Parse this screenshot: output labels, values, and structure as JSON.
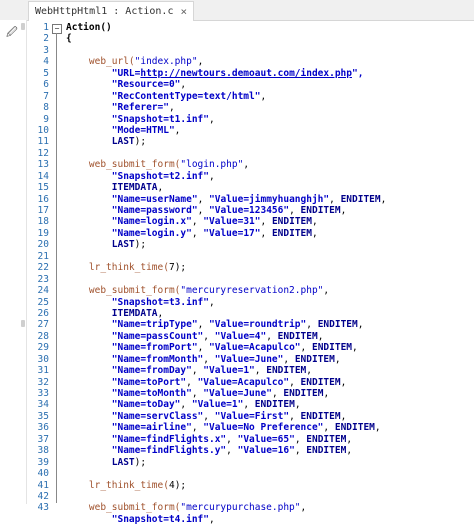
{
  "tab": {
    "title": "WebHttpHtml1 : Action.c",
    "close": "×"
  },
  "line_numbers": [
    "1",
    "2",
    "3",
    "4",
    "5",
    "6",
    "7",
    "8",
    "9",
    "10",
    "11",
    "12",
    "13",
    "14",
    "15",
    "16",
    "17",
    "18",
    "19",
    "20",
    "21",
    "22",
    "23",
    "24",
    "25",
    "26",
    "27",
    "28",
    "29",
    "30",
    "31",
    "32",
    "33",
    "34",
    "35",
    "36",
    "37",
    "38",
    "39",
    "40",
    "41",
    "42",
    "43"
  ],
  "code_lines": [
    [
      {
        "t": "Action()",
        "c": "plain bold"
      }
    ],
    [
      {
        "t": "{",
        "c": "plain bold"
      }
    ],
    [],
    [
      {
        "t": "    web_url(",
        "c": "fn"
      },
      {
        "t": "\"index.php\"",
        "c": "str"
      },
      {
        "t": ",",
        "c": "sep"
      }
    ],
    [
      {
        "t": "        \"URL=",
        "c": "str bold"
      },
      {
        "t": "http://newtours.demoaut.com/index.php",
        "c": "url"
      },
      {
        "t": "\",",
        "c": "str bold"
      }
    ],
    [
      {
        "t": "        \"Resource=0\"",
        "c": "str bold"
      },
      {
        "t": ",",
        "c": "sep"
      }
    ],
    [
      {
        "t": "        \"RecContentType=text/html\"",
        "c": "str bold"
      },
      {
        "t": ",",
        "c": "sep"
      }
    ],
    [
      {
        "t": "        \"Referer=\"",
        "c": "str bold"
      },
      {
        "t": ",",
        "c": "sep"
      }
    ],
    [
      {
        "t": "        \"Snapshot=t1.inf\"",
        "c": "str bold"
      },
      {
        "t": ",",
        "c": "sep"
      }
    ],
    [
      {
        "t": "        \"Mode=HTML\"",
        "c": "str bold"
      },
      {
        "t": ",",
        "c": "sep"
      }
    ],
    [
      {
        "t": "        LAST",
        "c": "kw"
      },
      {
        "t": ");",
        "c": "sep"
      }
    ],
    [],
    [
      {
        "t": "    web_submit_form(",
        "c": "fn"
      },
      {
        "t": "\"login.php\"",
        "c": "str"
      },
      {
        "t": ",",
        "c": "sep"
      }
    ],
    [
      {
        "t": "        \"Snapshot=t2.inf\"",
        "c": "str bold"
      },
      {
        "t": ",",
        "c": "sep"
      }
    ],
    [
      {
        "t": "        ITEMDATA",
        "c": "kw"
      },
      {
        "t": ",",
        "c": "sep"
      }
    ],
    [
      {
        "t": "        \"Name=userName\"",
        "c": "str bold"
      },
      {
        "t": ", ",
        "c": "sep"
      },
      {
        "t": "\"Value=jimmyhuanghjh\"",
        "c": "str bold"
      },
      {
        "t": ", ",
        "c": "sep"
      },
      {
        "t": "ENDITEM",
        "c": "kw"
      },
      {
        "t": ",",
        "c": "sep"
      }
    ],
    [
      {
        "t": "        \"Name=password\"",
        "c": "str bold"
      },
      {
        "t": ", ",
        "c": "sep"
      },
      {
        "t": "\"Value=123456\"",
        "c": "str bold"
      },
      {
        "t": ", ",
        "c": "sep"
      },
      {
        "t": "ENDITEM",
        "c": "kw"
      },
      {
        "t": ",",
        "c": "sep"
      }
    ],
    [
      {
        "t": "        \"Name=login.x\"",
        "c": "str bold"
      },
      {
        "t": ", ",
        "c": "sep"
      },
      {
        "t": "\"Value=31\"",
        "c": "str bold"
      },
      {
        "t": ", ",
        "c": "sep"
      },
      {
        "t": "ENDITEM",
        "c": "kw"
      },
      {
        "t": ",",
        "c": "sep"
      }
    ],
    [
      {
        "t": "        \"Name=login.y\"",
        "c": "str bold"
      },
      {
        "t": ", ",
        "c": "sep"
      },
      {
        "t": "\"Value=17\"",
        "c": "str bold"
      },
      {
        "t": ", ",
        "c": "sep"
      },
      {
        "t": "ENDITEM",
        "c": "kw"
      },
      {
        "t": ",",
        "c": "sep"
      }
    ],
    [
      {
        "t": "        LAST",
        "c": "kw"
      },
      {
        "t": ");",
        "c": "sep"
      }
    ],
    [],
    [
      {
        "t": "    lr_think_time(",
        "c": "fn"
      },
      {
        "t": "7",
        "c": "num"
      },
      {
        "t": ");",
        "c": "sep"
      }
    ],
    [],
    [
      {
        "t": "    web_submit_form(",
        "c": "fn"
      },
      {
        "t": "\"mercuryreservation2.php\"",
        "c": "str"
      },
      {
        "t": ",",
        "c": "sep"
      }
    ],
    [
      {
        "t": "        \"Snapshot=t3.inf\"",
        "c": "str bold"
      },
      {
        "t": ",",
        "c": "sep"
      }
    ],
    [
      {
        "t": "        ITEMDATA",
        "c": "kw"
      },
      {
        "t": ",",
        "c": "sep"
      }
    ],
    [
      {
        "t": "        \"Name=tripType\"",
        "c": "str bold"
      },
      {
        "t": ", ",
        "c": "sep"
      },
      {
        "t": "\"Value=roundtrip\"",
        "c": "str bold"
      },
      {
        "t": ", ",
        "c": "sep"
      },
      {
        "t": "ENDITEM",
        "c": "kw"
      },
      {
        "t": ",",
        "c": "sep"
      }
    ],
    [
      {
        "t": "        \"Name=passCount\"",
        "c": "str bold"
      },
      {
        "t": ", ",
        "c": "sep"
      },
      {
        "t": "\"Value=4\"",
        "c": "str bold"
      },
      {
        "t": ", ",
        "c": "sep"
      },
      {
        "t": "ENDITEM",
        "c": "kw"
      },
      {
        "t": ",",
        "c": "sep"
      }
    ],
    [
      {
        "t": "        \"Name=fromPort\"",
        "c": "str bold"
      },
      {
        "t": ", ",
        "c": "sep"
      },
      {
        "t": "\"Value=Acapulco\"",
        "c": "str bold"
      },
      {
        "t": ", ",
        "c": "sep"
      },
      {
        "t": "ENDITEM",
        "c": "kw"
      },
      {
        "t": ",",
        "c": "sep"
      }
    ],
    [
      {
        "t": "        \"Name=fromMonth\"",
        "c": "str bold"
      },
      {
        "t": ", ",
        "c": "sep"
      },
      {
        "t": "\"Value=June\"",
        "c": "str bold"
      },
      {
        "t": ", ",
        "c": "sep"
      },
      {
        "t": "ENDITEM",
        "c": "kw"
      },
      {
        "t": ",",
        "c": "sep"
      }
    ],
    [
      {
        "t": "        \"Name=fromDay\"",
        "c": "str bold"
      },
      {
        "t": ", ",
        "c": "sep"
      },
      {
        "t": "\"Value=1\"",
        "c": "str bold"
      },
      {
        "t": ", ",
        "c": "sep"
      },
      {
        "t": "ENDITEM",
        "c": "kw"
      },
      {
        "t": ",",
        "c": "sep"
      }
    ],
    [
      {
        "t": "        \"Name=toPort\"",
        "c": "str bold"
      },
      {
        "t": ", ",
        "c": "sep"
      },
      {
        "t": "\"Value=Acapulco\"",
        "c": "str bold"
      },
      {
        "t": ", ",
        "c": "sep"
      },
      {
        "t": "ENDITEM",
        "c": "kw"
      },
      {
        "t": ",",
        "c": "sep"
      }
    ],
    [
      {
        "t": "        \"Name=toMonth\"",
        "c": "str bold"
      },
      {
        "t": ", ",
        "c": "sep"
      },
      {
        "t": "\"Value=June\"",
        "c": "str bold"
      },
      {
        "t": ", ",
        "c": "sep"
      },
      {
        "t": "ENDITEM",
        "c": "kw"
      },
      {
        "t": ",",
        "c": "sep"
      }
    ],
    [
      {
        "t": "        \"Name=toDay\"",
        "c": "str bold"
      },
      {
        "t": ", ",
        "c": "sep"
      },
      {
        "t": "\"Value=1\"",
        "c": "str bold"
      },
      {
        "t": ", ",
        "c": "sep"
      },
      {
        "t": "ENDITEM",
        "c": "kw"
      },
      {
        "t": ",",
        "c": "sep"
      }
    ],
    [
      {
        "t": "        \"Name=servClass\"",
        "c": "str bold"
      },
      {
        "t": ", ",
        "c": "sep"
      },
      {
        "t": "\"Value=First\"",
        "c": "str bold"
      },
      {
        "t": ", ",
        "c": "sep"
      },
      {
        "t": "ENDITEM",
        "c": "kw"
      },
      {
        "t": ",",
        "c": "sep"
      }
    ],
    [
      {
        "t": "        \"Name=airline\"",
        "c": "str bold"
      },
      {
        "t": ", ",
        "c": "sep"
      },
      {
        "t": "\"Value=No Preference\"",
        "c": "str bold"
      },
      {
        "t": ", ",
        "c": "sep"
      },
      {
        "t": "ENDITEM",
        "c": "kw"
      },
      {
        "t": ",",
        "c": "sep"
      }
    ],
    [
      {
        "t": "        \"Name=findFlights.x\"",
        "c": "str bold"
      },
      {
        "t": ", ",
        "c": "sep"
      },
      {
        "t": "\"Value=65\"",
        "c": "str bold"
      },
      {
        "t": ", ",
        "c": "sep"
      },
      {
        "t": "ENDITEM",
        "c": "kw"
      },
      {
        "t": ",",
        "c": "sep"
      }
    ],
    [
      {
        "t": "        \"Name=findFlights.y\"",
        "c": "str bold"
      },
      {
        "t": ", ",
        "c": "sep"
      },
      {
        "t": "\"Value=16\"",
        "c": "str bold"
      },
      {
        "t": ", ",
        "c": "sep"
      },
      {
        "t": "ENDITEM",
        "c": "kw"
      },
      {
        "t": ",",
        "c": "sep"
      }
    ],
    [
      {
        "t": "        LAST",
        "c": "kw"
      },
      {
        "t": ");",
        "c": "sep"
      }
    ],
    [],
    [
      {
        "t": "    lr_think_time(",
        "c": "fn"
      },
      {
        "t": "4",
        "c": "num"
      },
      {
        "t": ");",
        "c": "sep"
      }
    ],
    [],
    [
      {
        "t": "    web_submit_form(",
        "c": "fn"
      },
      {
        "t": "\"mercurypurchase.php\"",
        "c": "str"
      },
      {
        "t": ",",
        "c": "sep"
      }
    ],
    [
      {
        "t": "        \"Snapshot=t4.inf\"",
        "c": "str bold"
      },
      {
        "t": ",",
        "c": "sep"
      }
    ]
  ]
}
